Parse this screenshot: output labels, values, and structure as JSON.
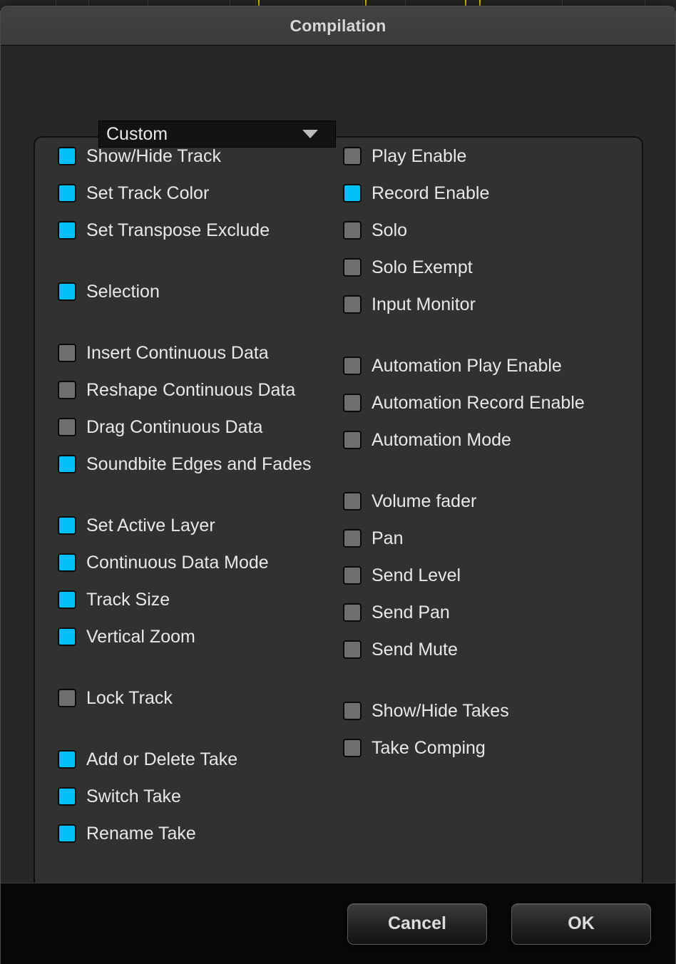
{
  "window": {
    "title": "Compilation"
  },
  "preset": {
    "selected": "Custom",
    "caret_icon": "chevron-down-icon"
  },
  "options": {
    "left_column": [
      {
        "label": "Show/Hide Track",
        "checked": true,
        "gap": "none"
      },
      {
        "label": "Set Track Color",
        "checked": true,
        "gap": "none"
      },
      {
        "label": "Set Transpose Exclude",
        "checked": true,
        "gap": "none"
      },
      {
        "label": "Selection",
        "checked": true,
        "gap": "md"
      },
      {
        "label": "Insert Continuous Data",
        "checked": false,
        "gap": "md"
      },
      {
        "label": "Reshape Continuous Data",
        "checked": false,
        "gap": "none"
      },
      {
        "label": "Drag Continuous Data",
        "checked": false,
        "gap": "none"
      },
      {
        "label": "Soundbite Edges and Fades",
        "checked": true,
        "gap": "none"
      },
      {
        "label": "Set Active Layer",
        "checked": true,
        "gap": "md"
      },
      {
        "label": "Continuous Data Mode",
        "checked": true,
        "gap": "none"
      },
      {
        "label": "Track Size",
        "checked": true,
        "gap": "none"
      },
      {
        "label": "Vertical Zoom",
        "checked": true,
        "gap": "none"
      },
      {
        "label": "Lock Track",
        "checked": false,
        "gap": "md"
      },
      {
        "label": "Add or Delete Take",
        "checked": true,
        "gap": "md"
      },
      {
        "label": "Switch Take",
        "checked": true,
        "gap": "none"
      },
      {
        "label": "Rename Take",
        "checked": true,
        "gap": "none"
      }
    ],
    "right_column": [
      {
        "label": "Play Enable",
        "checked": false,
        "gap": "none"
      },
      {
        "label": "Record Enable",
        "checked": true,
        "gap": "none"
      },
      {
        "label": "Solo",
        "checked": false,
        "gap": "none"
      },
      {
        "label": "Solo Exempt",
        "checked": false,
        "gap": "none"
      },
      {
        "label": "Input Monitor",
        "checked": false,
        "gap": "none"
      },
      {
        "label": "Automation Play Enable",
        "checked": false,
        "gap": "md"
      },
      {
        "label": "Automation Record Enable",
        "checked": false,
        "gap": "none"
      },
      {
        "label": "Automation Mode",
        "checked": false,
        "gap": "none"
      },
      {
        "label": "Volume fader",
        "checked": false,
        "gap": "md"
      },
      {
        "label": "Pan",
        "checked": false,
        "gap": "none"
      },
      {
        "label": "Send Level",
        "checked": false,
        "gap": "none"
      },
      {
        "label": "Send Pan",
        "checked": false,
        "gap": "none"
      },
      {
        "label": "Send Mute",
        "checked": false,
        "gap": "none"
      },
      {
        "label": "Show/Hide Takes",
        "checked": false,
        "gap": "md"
      },
      {
        "label": "Take Comping",
        "checked": false,
        "gap": "none"
      }
    ]
  },
  "footer": {
    "cancel_label": "Cancel",
    "ok_label": "OK"
  },
  "colors": {
    "checkbox_checked": "#00c0f8",
    "checkbox_unchecked": "#6e6e6e",
    "dialog_background": "#272727",
    "titlebar": "#3e3e3e",
    "text": "#e8e8e8",
    "marker_yellow": "#f4e300"
  }
}
